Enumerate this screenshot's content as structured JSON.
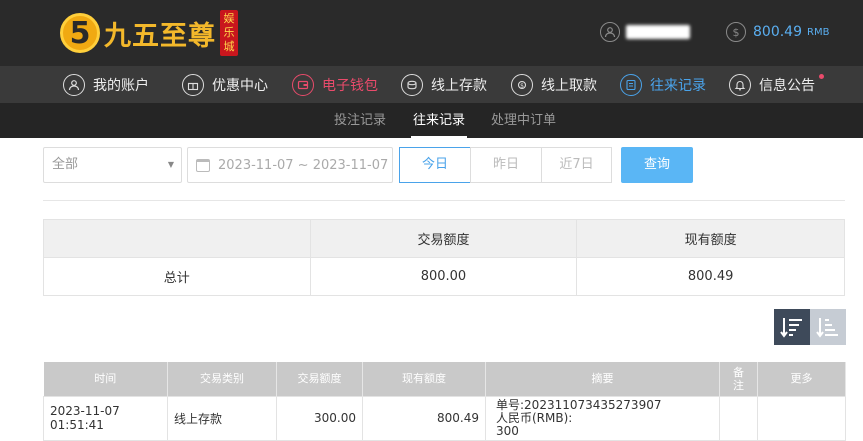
{
  "header": {
    "logo_mark": "5",
    "logo_text": "九五至尊",
    "logo_badge": "娱乐城",
    "balance_amount": "800.49",
    "balance_currency": "RMB"
  },
  "nav": [
    {
      "label": "我的账户",
      "icon": "user-icon"
    },
    {
      "label": "优惠中心",
      "icon": "gift-icon"
    },
    {
      "label": "电子钱包",
      "icon": "wallet-icon"
    },
    {
      "label": "线上存款",
      "icon": "deposit-icon"
    },
    {
      "label": "线上取款",
      "icon": "withdraw-icon"
    },
    {
      "label": "往来记录",
      "icon": "records-icon"
    },
    {
      "label": "信息公告",
      "icon": "bell-icon"
    }
  ],
  "subtabs": [
    "投注记录",
    "往来记录",
    "处理中订单"
  ],
  "filter": {
    "type_selected": "全部",
    "date_range": "2023-11-07 ~ 2023-11-07",
    "quick": [
      "今日",
      "昨日",
      "近7日"
    ],
    "query_label": "查询"
  },
  "summary": {
    "headers": [
      "",
      "交易额度",
      "现有额度"
    ],
    "row": [
      "总计",
      "800.00",
      "800.49"
    ]
  },
  "detail": {
    "headers": [
      "时间",
      "交易类别",
      "交易额度",
      "现有额度",
      "摘要",
      "备注",
      "更多"
    ],
    "rows": [
      {
        "time": "2023-11-07 01:51:41",
        "type": "线上存款",
        "amount": "300.00",
        "balance": "800.49",
        "memo_line1": "单号:202311073435273907",
        "memo_line2": "人民币(RMB):",
        "memo_line3": "300",
        "note": "",
        "more": ""
      }
    ]
  },
  "colors": {
    "accent_blue": "#4aa3ea",
    "active_red": "#e94b6b",
    "logo_gold": "#f3b82b"
  }
}
